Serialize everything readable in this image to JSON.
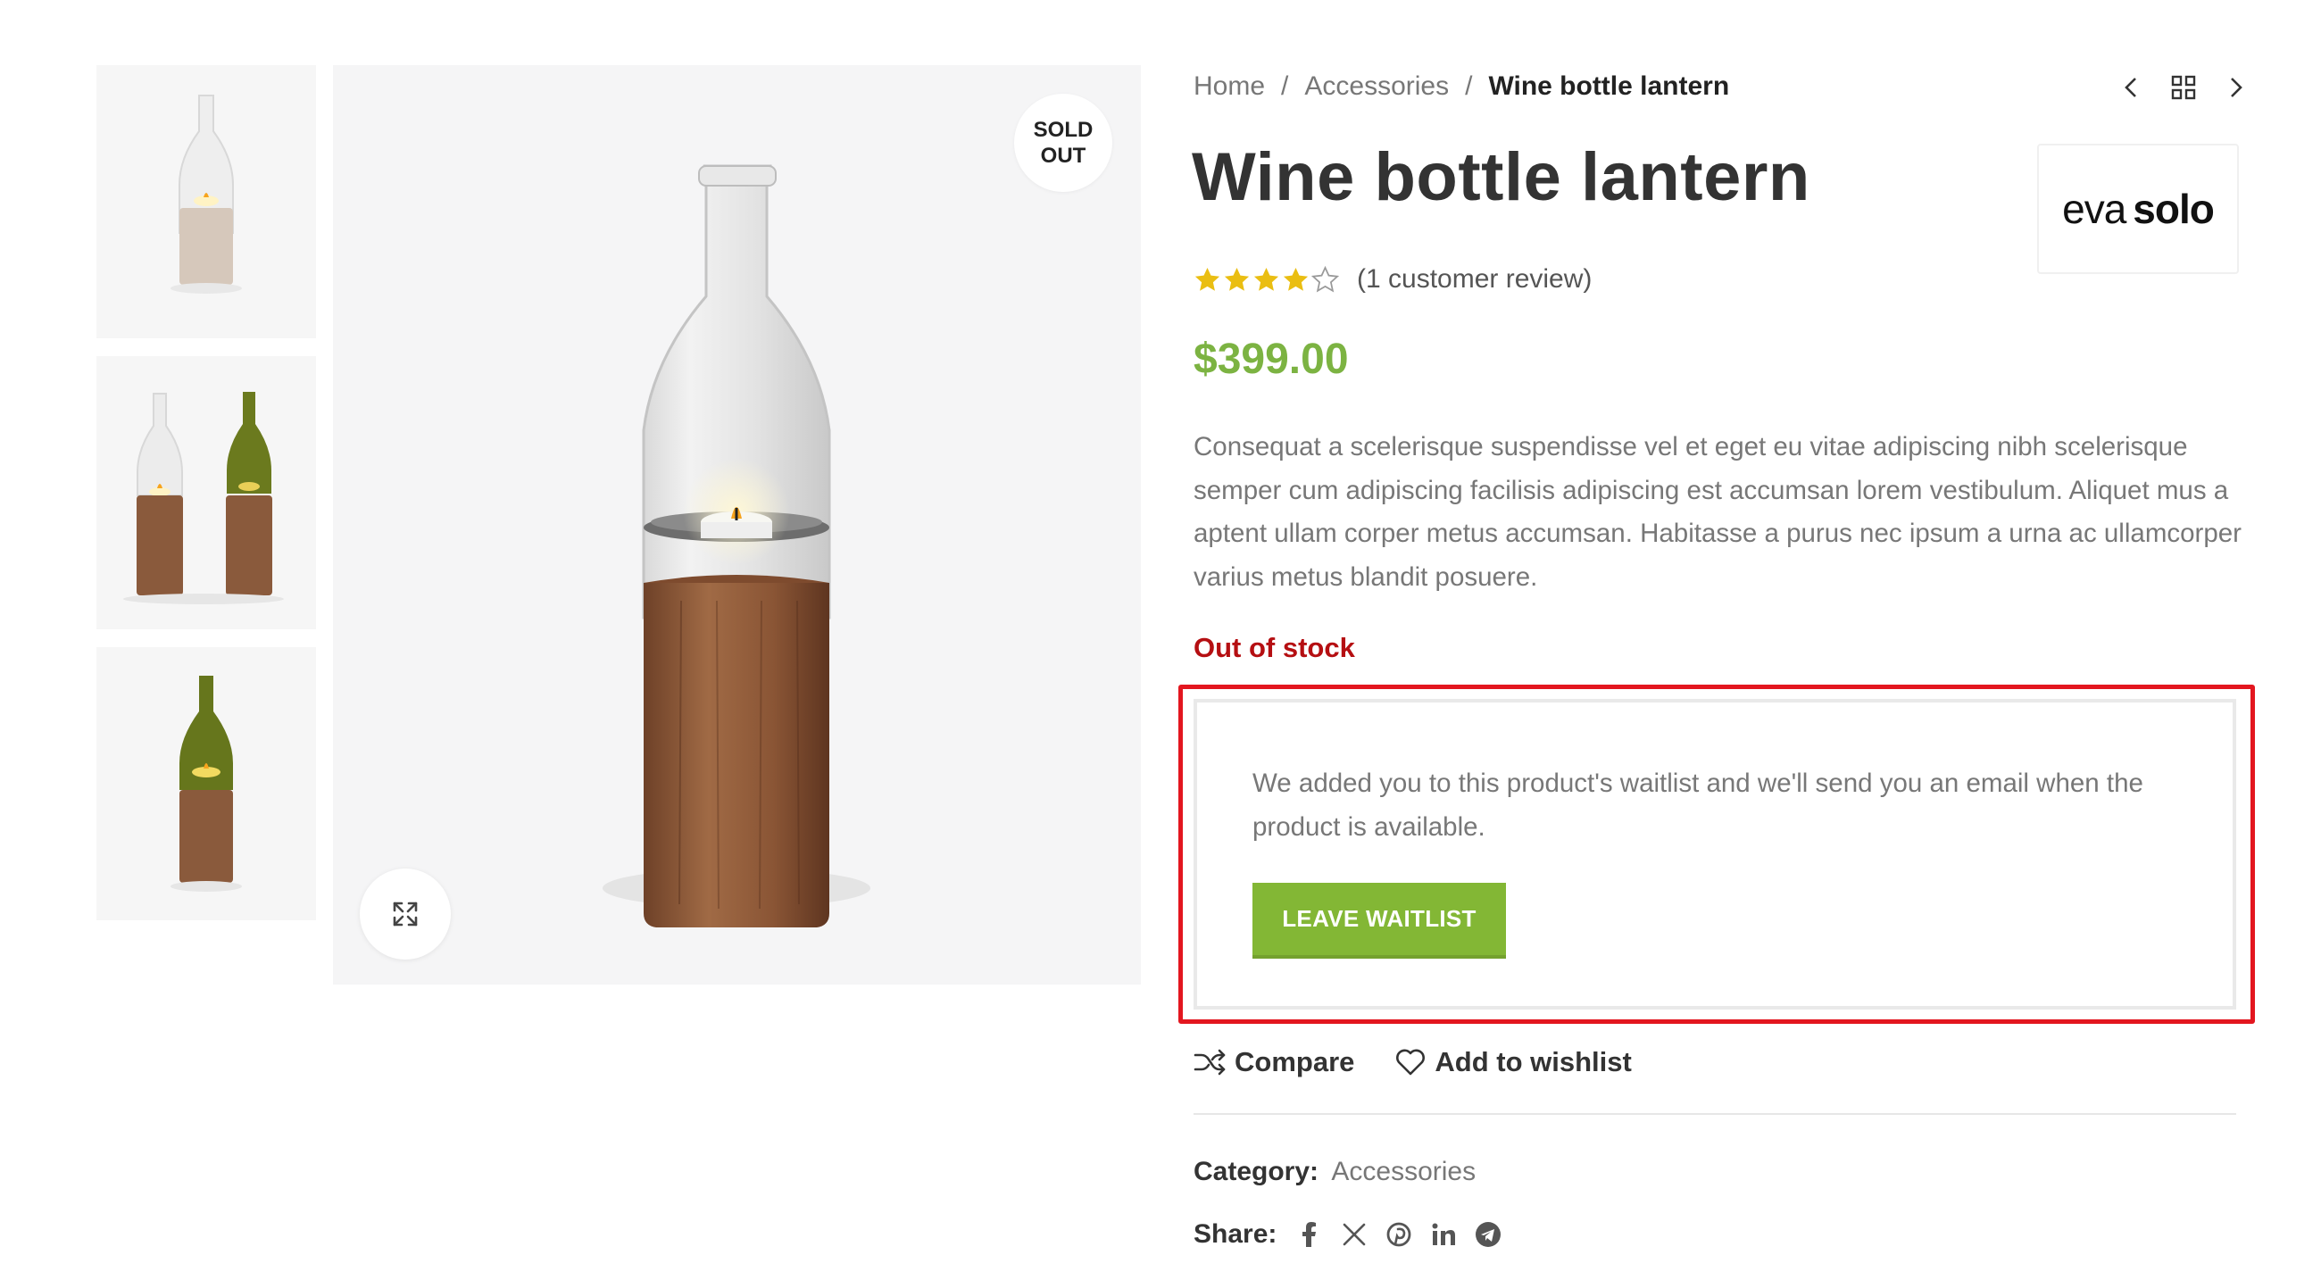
{
  "breadcrumb": {
    "home": "Home",
    "separator": "/",
    "category": "Accessories",
    "current": "Wine bottle lantern"
  },
  "nav": {
    "prev_icon": "chevron-left-icon",
    "grid_icon": "grid-icon",
    "next_icon": "chevron-right-icon"
  },
  "gallery": {
    "badge_line1": "SOLD",
    "badge_line2": "OUT",
    "zoom_icon": "expand-icon",
    "thumbnails": [
      "clear-lantern",
      "clear-and-green-lanterns",
      "green-lantern"
    ]
  },
  "product": {
    "title": "Wine bottle lantern",
    "brand_light": "eva",
    "brand_bold": "solo",
    "rating": 4,
    "rating_max": 5,
    "review_text": "(1 customer review)",
    "price": "$399.00",
    "description": "Consequat a scelerisque suspendisse vel et eget eu vitae adipiscing nibh scelerisque semper cum adipiscing facilisis adipiscing est accumsan lorem vestibulum. Aliquet mus a aptent ullam corper metus accumsan. Habitasse a purus nec ipsum a urna ac ullamcorper varius metus blandit posuere.",
    "stock_status": "Out of stock"
  },
  "waitlist": {
    "message": "We added you to this product's waitlist and we'll send you an email when the product is available.",
    "button_label": "LEAVE WAITLIST"
  },
  "actions": {
    "compare": "Compare",
    "wishlist": "Add to wishlist"
  },
  "meta": {
    "category_label": "Category:",
    "category_value": "Accessories",
    "share_label": "Share:",
    "share_icons": [
      "facebook-icon",
      "x-icon",
      "pinterest-icon",
      "linkedin-icon",
      "telegram-icon"
    ]
  },
  "colors": {
    "price": "#7cb342",
    "button": "#83b735",
    "stock": "#b50f12",
    "highlight": "#e3161f",
    "star": "#eabe12"
  }
}
